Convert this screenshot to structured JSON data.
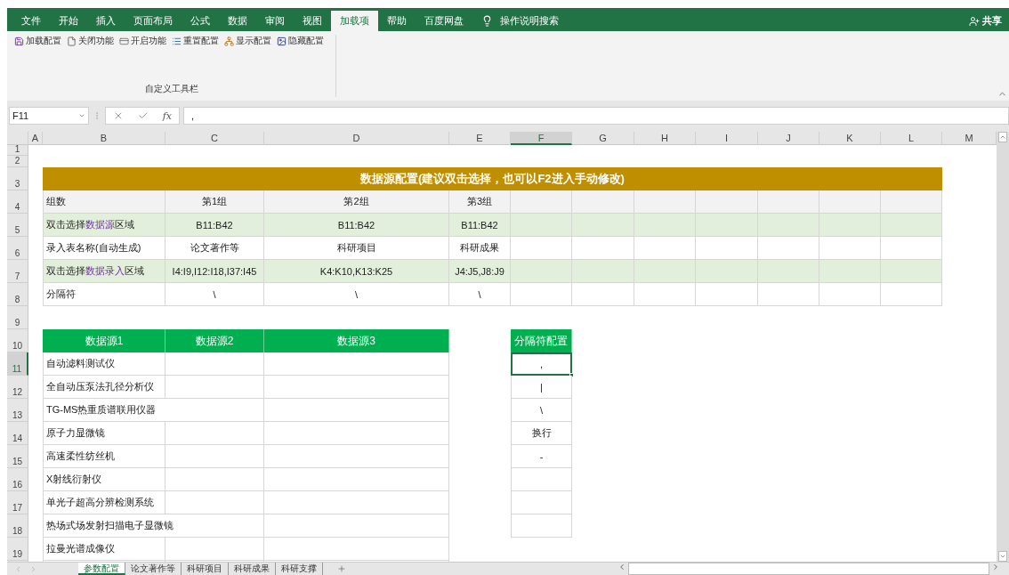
{
  "ribbon": {
    "tabs": [
      {
        "label": "文件",
        "selected": false
      },
      {
        "label": "开始",
        "selected": false
      },
      {
        "label": "插入",
        "selected": false
      },
      {
        "label": "页面布局",
        "selected": false
      },
      {
        "label": "公式",
        "selected": false
      },
      {
        "label": "数据",
        "selected": false
      },
      {
        "label": "审阅",
        "selected": false
      },
      {
        "label": "视图",
        "selected": false
      },
      {
        "label": "加载项",
        "selected": true
      },
      {
        "label": "帮助",
        "selected": false
      },
      {
        "label": "百度网盘",
        "selected": false
      }
    ],
    "search": "操作说明搜索",
    "share": "共享",
    "commands": [
      {
        "kind": "save",
        "label": "加载配置"
      },
      {
        "kind": "page",
        "label": "关闭功能"
      },
      {
        "kind": "card",
        "label": "开启功能"
      },
      {
        "kind": "list",
        "label": "重置配置"
      },
      {
        "kind": "network",
        "label": "显示配置"
      },
      {
        "kind": "picture",
        "label": "隐藏配置"
      }
    ],
    "group_label": "自定义工具栏"
  },
  "formula_bar": {
    "name_box": "F11",
    "fx": "fx",
    "value": ","
  },
  "sheet": {
    "columns": [
      {
        "label": "A",
        "selected": false
      },
      {
        "label": "B",
        "selected": false
      },
      {
        "label": "C",
        "selected": false
      },
      {
        "label": "D",
        "selected": false
      },
      {
        "label": "E",
        "selected": false
      },
      {
        "label": "F",
        "selected": true
      },
      {
        "label": "G",
        "selected": false
      },
      {
        "label": "H",
        "selected": false
      },
      {
        "label": "I",
        "selected": false
      },
      {
        "label": "J",
        "selected": false
      },
      {
        "label": "K",
        "selected": false
      },
      {
        "label": "L",
        "selected": false
      },
      {
        "label": "M",
        "selected": false
      }
    ],
    "rows": [
      {
        "label": "1",
        "selected": false
      },
      {
        "label": "2",
        "selected": false
      },
      {
        "label": "3",
        "selected": false
      },
      {
        "label": "4",
        "selected": false
      },
      {
        "label": "5",
        "selected": false
      },
      {
        "label": "6",
        "selected": false
      },
      {
        "label": "7",
        "selected": false
      },
      {
        "label": "8",
        "selected": false
      },
      {
        "label": "9",
        "selected": false
      },
      {
        "label": "10",
        "selected": false
      },
      {
        "label": "11",
        "selected": true
      },
      {
        "label": "12",
        "selected": false
      },
      {
        "label": "13",
        "selected": false
      },
      {
        "label": "14",
        "selected": false
      },
      {
        "label": "15",
        "selected": false
      },
      {
        "label": "16",
        "selected": false
      },
      {
        "label": "17",
        "selected": false
      },
      {
        "label": "18",
        "selected": false
      },
      {
        "label": "19",
        "selected": false
      }
    ]
  },
  "config_table": {
    "title": "数据源配置(建议双击选择，也可以F2进入手动修改)",
    "rows": [
      {
        "kind": "header",
        "cells": [
          "组数",
          "第1组",
          "第2组",
          "第3组"
        ]
      },
      {
        "kind": "shaded",
        "cells": [
          "双击选择**数据源**区域",
          "B11:B42",
          "B11:B42",
          "B11:B42"
        ]
      },
      {
        "kind": "plain",
        "cells": [
          "录入表名称(自动生成)",
          "论文著作等",
          "科研项目",
          "科研成果"
        ]
      },
      {
        "kind": "shaded",
        "cells": [
          "双击选择**数据录入**区域",
          "I4:I9,I12:I18,I37:I45",
          "K4:K10,K13:K25",
          "J4:J5,J8:J9"
        ]
      },
      {
        "kind": "plain",
        "cells": [
          "分隔符",
          "\\",
          "\\",
          "\\"
        ]
      }
    ]
  },
  "source_table": {
    "headers": [
      "数据源1",
      "数据源2",
      "数据源3"
    ],
    "rows": [
      "自动滤料测试仪",
      "全自动压泵法孔径分析仪",
      "TG-MS热重质谱联用仪器",
      "原子力显微镜",
      "高速柔性纺丝机",
      "X射线衍射仪",
      "单光子超高分辨检测系统",
      "热场式场发射扫描电子显微镜",
      "拉曼光谱成像仪"
    ]
  },
  "separator_config": {
    "header": "分隔符配置",
    "items": [
      {
        "value": ",",
        "selected": true
      },
      {
        "value": "|",
        "selected": false
      },
      {
        "value": "\\",
        "selected": false
      },
      {
        "value": "换行",
        "selected": false
      },
      {
        "value": "-",
        "selected": false
      }
    ]
  },
  "sheet_tabs": [
    {
      "label": "参数配置",
      "selected": true
    },
    {
      "label": "论文著作等",
      "selected": false
    },
    {
      "label": "科研项目",
      "selected": false
    },
    {
      "label": "科研成果",
      "selected": false
    },
    {
      "label": "科研支撑",
      "selected": false
    }
  ]
}
